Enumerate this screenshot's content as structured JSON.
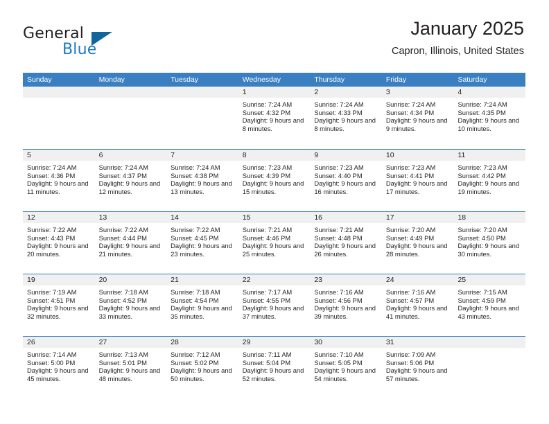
{
  "brand": {
    "name_part1": "General",
    "name_part2": "Blue",
    "triangle_icon": "triangle-icon",
    "accent_blue": "#1a7bc4",
    "triangle_color": "#12649f"
  },
  "header": {
    "title": "January 2025",
    "location": "Capron, Illinois, United States"
  },
  "theme": {
    "header_blue": "#3a7fc1",
    "daynum_band": "#f0f0f0",
    "text": "#231f20"
  },
  "weekdays": [
    "Sunday",
    "Monday",
    "Tuesday",
    "Wednesday",
    "Thursday",
    "Friday",
    "Saturday"
  ],
  "weeks": [
    [
      {
        "day": "",
        "sunrise": "",
        "sunset": "",
        "daylight": "",
        "empty": true
      },
      {
        "day": "",
        "sunrise": "",
        "sunset": "",
        "daylight": "",
        "empty": true
      },
      {
        "day": "",
        "sunrise": "",
        "sunset": "",
        "daylight": "",
        "empty": true
      },
      {
        "day": "1",
        "sunrise": "Sunrise: 7:24 AM",
        "sunset": "Sunset: 4:32 PM",
        "daylight": "Daylight: 9 hours and 8 minutes.",
        "empty": false
      },
      {
        "day": "2",
        "sunrise": "Sunrise: 7:24 AM",
        "sunset": "Sunset: 4:33 PM",
        "daylight": "Daylight: 9 hours and 8 minutes.",
        "empty": false
      },
      {
        "day": "3",
        "sunrise": "Sunrise: 7:24 AM",
        "sunset": "Sunset: 4:34 PM",
        "daylight": "Daylight: 9 hours and 9 minutes.",
        "empty": false
      },
      {
        "day": "4",
        "sunrise": "Sunrise: 7:24 AM",
        "sunset": "Sunset: 4:35 PM",
        "daylight": "Daylight: 9 hours and 10 minutes.",
        "empty": false
      }
    ],
    [
      {
        "day": "5",
        "sunrise": "Sunrise: 7:24 AM",
        "sunset": "Sunset: 4:36 PM",
        "daylight": "Daylight: 9 hours and 11 minutes.",
        "empty": false
      },
      {
        "day": "6",
        "sunrise": "Sunrise: 7:24 AM",
        "sunset": "Sunset: 4:37 PM",
        "daylight": "Daylight: 9 hours and 12 minutes.",
        "empty": false
      },
      {
        "day": "7",
        "sunrise": "Sunrise: 7:24 AM",
        "sunset": "Sunset: 4:38 PM",
        "daylight": "Daylight: 9 hours and 13 minutes.",
        "empty": false
      },
      {
        "day": "8",
        "sunrise": "Sunrise: 7:23 AM",
        "sunset": "Sunset: 4:39 PM",
        "daylight": "Daylight: 9 hours and 15 minutes.",
        "empty": false
      },
      {
        "day": "9",
        "sunrise": "Sunrise: 7:23 AM",
        "sunset": "Sunset: 4:40 PM",
        "daylight": "Daylight: 9 hours and 16 minutes.",
        "empty": false
      },
      {
        "day": "10",
        "sunrise": "Sunrise: 7:23 AM",
        "sunset": "Sunset: 4:41 PM",
        "daylight": "Daylight: 9 hours and 17 minutes.",
        "empty": false
      },
      {
        "day": "11",
        "sunrise": "Sunrise: 7:23 AM",
        "sunset": "Sunset: 4:42 PM",
        "daylight": "Daylight: 9 hours and 19 minutes.",
        "empty": false
      }
    ],
    [
      {
        "day": "12",
        "sunrise": "Sunrise: 7:22 AM",
        "sunset": "Sunset: 4:43 PM",
        "daylight": "Daylight: 9 hours and 20 minutes.",
        "empty": false
      },
      {
        "day": "13",
        "sunrise": "Sunrise: 7:22 AM",
        "sunset": "Sunset: 4:44 PM",
        "daylight": "Daylight: 9 hours and 21 minutes.",
        "empty": false
      },
      {
        "day": "14",
        "sunrise": "Sunrise: 7:22 AM",
        "sunset": "Sunset: 4:45 PM",
        "daylight": "Daylight: 9 hours and 23 minutes.",
        "empty": false
      },
      {
        "day": "15",
        "sunrise": "Sunrise: 7:21 AM",
        "sunset": "Sunset: 4:46 PM",
        "daylight": "Daylight: 9 hours and 25 minutes.",
        "empty": false
      },
      {
        "day": "16",
        "sunrise": "Sunrise: 7:21 AM",
        "sunset": "Sunset: 4:48 PM",
        "daylight": "Daylight: 9 hours and 26 minutes.",
        "empty": false
      },
      {
        "day": "17",
        "sunrise": "Sunrise: 7:20 AM",
        "sunset": "Sunset: 4:49 PM",
        "daylight": "Daylight: 9 hours and 28 minutes.",
        "empty": false
      },
      {
        "day": "18",
        "sunrise": "Sunrise: 7:20 AM",
        "sunset": "Sunset: 4:50 PM",
        "daylight": "Daylight: 9 hours and 30 minutes.",
        "empty": false
      }
    ],
    [
      {
        "day": "19",
        "sunrise": "Sunrise: 7:19 AM",
        "sunset": "Sunset: 4:51 PM",
        "daylight": "Daylight: 9 hours and 32 minutes.",
        "empty": false
      },
      {
        "day": "20",
        "sunrise": "Sunrise: 7:18 AM",
        "sunset": "Sunset: 4:52 PM",
        "daylight": "Daylight: 9 hours and 33 minutes.",
        "empty": false
      },
      {
        "day": "21",
        "sunrise": "Sunrise: 7:18 AM",
        "sunset": "Sunset: 4:54 PM",
        "daylight": "Daylight: 9 hours and 35 minutes.",
        "empty": false
      },
      {
        "day": "22",
        "sunrise": "Sunrise: 7:17 AM",
        "sunset": "Sunset: 4:55 PM",
        "daylight": "Daylight: 9 hours and 37 minutes.",
        "empty": false
      },
      {
        "day": "23",
        "sunrise": "Sunrise: 7:16 AM",
        "sunset": "Sunset: 4:56 PM",
        "daylight": "Daylight: 9 hours and 39 minutes.",
        "empty": false
      },
      {
        "day": "24",
        "sunrise": "Sunrise: 7:16 AM",
        "sunset": "Sunset: 4:57 PM",
        "daylight": "Daylight: 9 hours and 41 minutes.",
        "empty": false
      },
      {
        "day": "25",
        "sunrise": "Sunrise: 7:15 AM",
        "sunset": "Sunset: 4:59 PM",
        "daylight": "Daylight: 9 hours and 43 minutes.",
        "empty": false
      }
    ],
    [
      {
        "day": "26",
        "sunrise": "Sunrise: 7:14 AM",
        "sunset": "Sunset: 5:00 PM",
        "daylight": "Daylight: 9 hours and 45 minutes.",
        "empty": false
      },
      {
        "day": "27",
        "sunrise": "Sunrise: 7:13 AM",
        "sunset": "Sunset: 5:01 PM",
        "daylight": "Daylight: 9 hours and 48 minutes.",
        "empty": false
      },
      {
        "day": "28",
        "sunrise": "Sunrise: 7:12 AM",
        "sunset": "Sunset: 5:02 PM",
        "daylight": "Daylight: 9 hours and 50 minutes.",
        "empty": false
      },
      {
        "day": "29",
        "sunrise": "Sunrise: 7:11 AM",
        "sunset": "Sunset: 5:04 PM",
        "daylight": "Daylight: 9 hours and 52 minutes.",
        "empty": false
      },
      {
        "day": "30",
        "sunrise": "Sunrise: 7:10 AM",
        "sunset": "Sunset: 5:05 PM",
        "daylight": "Daylight: 9 hours and 54 minutes.",
        "empty": false
      },
      {
        "day": "31",
        "sunrise": "Sunrise: 7:09 AM",
        "sunset": "Sunset: 5:06 PM",
        "daylight": "Daylight: 9 hours and 57 minutes.",
        "empty": false
      },
      {
        "day": "",
        "sunrise": "",
        "sunset": "",
        "daylight": "",
        "empty": true
      }
    ]
  ]
}
